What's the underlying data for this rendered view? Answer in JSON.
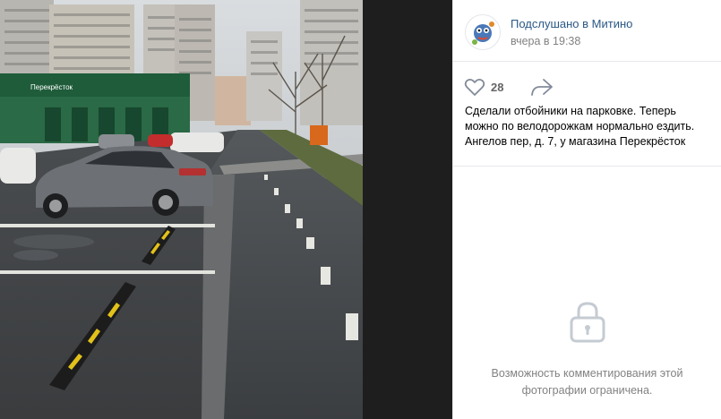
{
  "post": {
    "author": "Подслушано в Митино",
    "date": "вчера в 19:38",
    "likes": "28",
    "text_lines": [
      "Сделали отбойники на парковке. Теперь",
      "можно по велодорожкам нормально ездить.",
      "Ангелов пер, д. 7, у магазина Перекрёсток"
    ]
  },
  "photo": {
    "store_sign": "Перекрёсток"
  },
  "comments": {
    "line1": "Возможность комментирования этой",
    "line2": "фотографии ограничена."
  },
  "icons": {
    "like": "heart-icon",
    "share": "share-arrow-icon",
    "lock": "lock-icon"
  },
  "colors": {
    "link": "#2a5885",
    "muted": "#828282",
    "store_green": "#1e5c3a",
    "like_count": "#656565"
  }
}
